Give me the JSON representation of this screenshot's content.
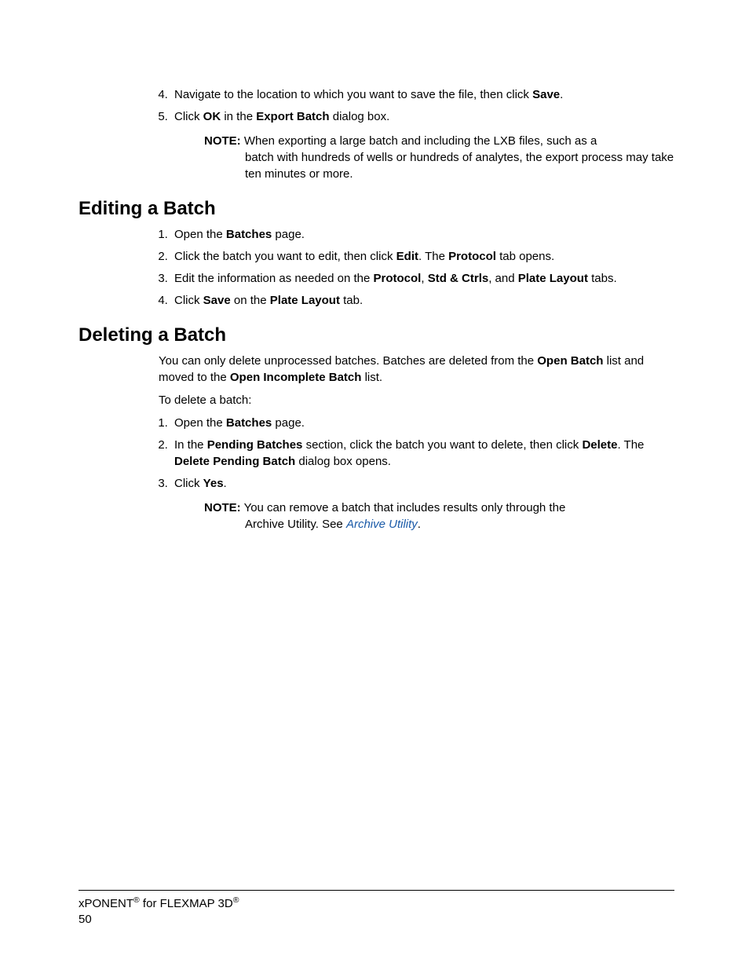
{
  "top_list": {
    "start": 4,
    "items": [
      {
        "pre": "Navigate to the location to which you want to save the file, then click ",
        "b1": "Save",
        "post": "."
      },
      {
        "pre": "Click ",
        "b1": "OK",
        "mid1": " in the ",
        "b2": "Export Batch",
        "post": " dialog box."
      }
    ]
  },
  "note1": {
    "label": "NOTE:",
    "line1": "When exporting a large batch and including the LXB files, such as a",
    "line2": "batch with hundreds of wells or hundreds of analytes, the export process may take ten minutes or more."
  },
  "section1": {
    "heading": "Editing a Batch",
    "items": [
      {
        "pre": "Open the ",
        "b1": "Batches",
        "post": " page."
      },
      {
        "pre": "Click the batch you want to edit, then click ",
        "b1": "Edit",
        "mid1": ". The ",
        "b2": "Protocol",
        "post": " tab opens."
      },
      {
        "pre": "Edit the information as needed on the ",
        "b1": "Protocol",
        "mid1": ", ",
        "b2": "Std & Ctrls",
        "mid2": ", and ",
        "b3": "Plate Layout",
        "post": " tabs."
      },
      {
        "pre": "Click ",
        "b1": "Save",
        "mid1": " on the ",
        "b2": "Plate Layout",
        "post": " tab."
      }
    ]
  },
  "section2": {
    "heading": "Deleting a Batch",
    "intro": {
      "pre": "You can only delete unprocessed batches. Batches are deleted from the ",
      "b1": "Open Batch",
      "mid1": " list and moved to the ",
      "b2": "Open Incomplete Batch",
      "post": " list."
    },
    "lead": "To delete a batch:",
    "items": [
      {
        "pre": "Open the ",
        "b1": "Batches",
        "post": " page."
      },
      {
        "pre": "In the ",
        "b1": "Pending Batches",
        "mid1": " section, click the batch you want to delete, then click ",
        "b2": "Delete",
        "mid2": ". The ",
        "b3": "Delete Pending Batch",
        "post": " dialog box opens."
      },
      {
        "pre": "Click ",
        "b1": "Yes",
        "post": "."
      }
    ]
  },
  "note2": {
    "label": "NOTE:",
    "line1": "You can remove a batch that includes results only through the",
    "line2_pre": "Archive Utility. See ",
    "link": "Archive Utility",
    "line2_post": "."
  },
  "footer": {
    "product1": "xPONENT",
    "mid": " for FLEXMAP 3D",
    "page": "50"
  }
}
